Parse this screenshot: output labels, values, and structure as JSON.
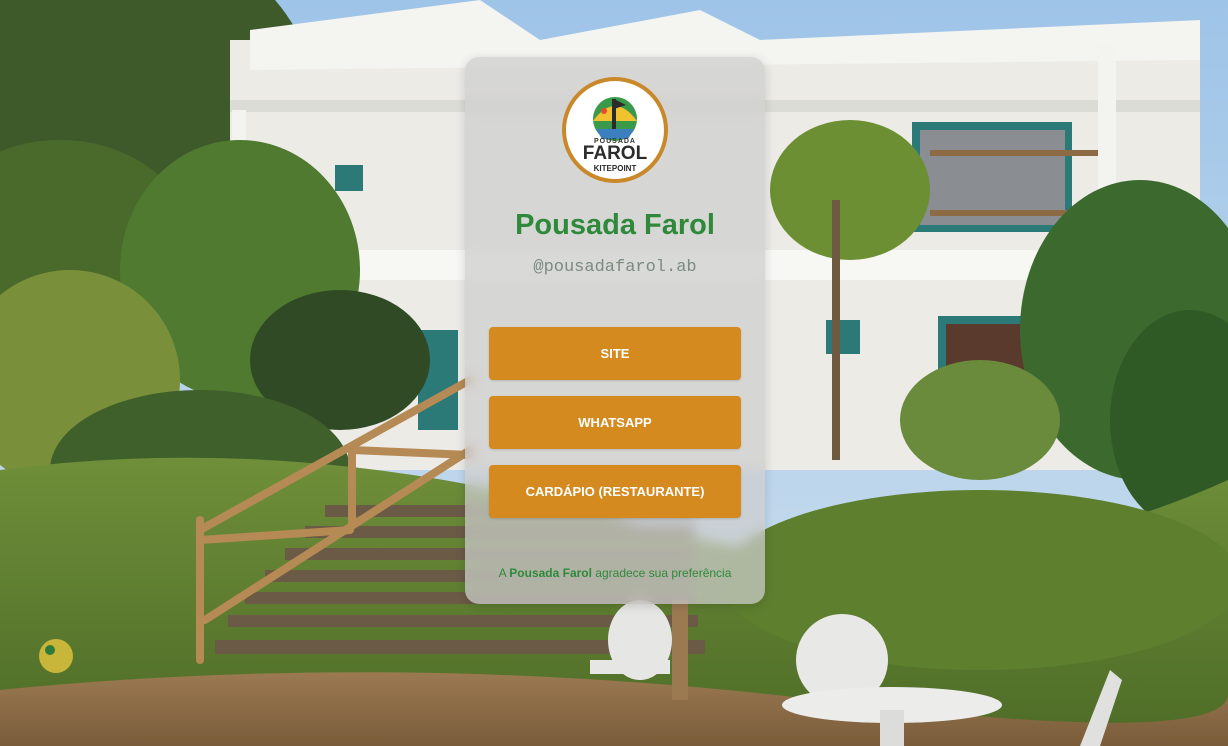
{
  "profile": {
    "title": "Pousada Farol",
    "handle": "@pousadafarol.ab"
  },
  "logo": {
    "top_text": "POUSADA",
    "main_text": "FAROL",
    "bottom_text": "KITEPOINT"
  },
  "links": [
    {
      "label": "SITE"
    },
    {
      "label": "WHATSAPP"
    },
    {
      "label": "CARDÁPIO (RESTAURANTE)"
    }
  ],
  "footer": {
    "prefix": "A ",
    "brand": "Pousada Farol",
    "suffix": " agradece sua preferência"
  },
  "colors": {
    "accent": "#d48a1e",
    "brand_green": "#2e8a3a",
    "card_bg": "rgba(205,205,205,0.72)"
  }
}
